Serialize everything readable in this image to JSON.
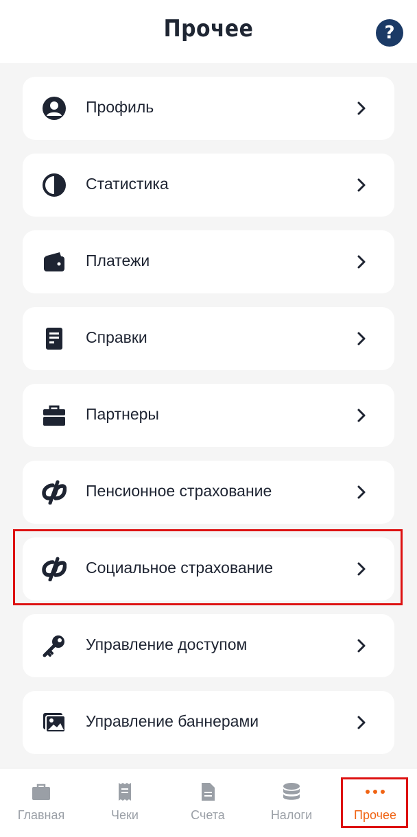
{
  "header": {
    "title": "Прочее",
    "help_label": "?"
  },
  "menu": {
    "items": [
      {
        "label": "Профиль",
        "icon": "user-circle-icon"
      },
      {
        "label": "Статистика",
        "icon": "pie-chart-icon"
      },
      {
        "label": "Платежи",
        "icon": "wallet-icon"
      },
      {
        "label": "Справки",
        "icon": "document-icon"
      },
      {
        "label": "Партнеры",
        "icon": "briefcase-icon"
      },
      {
        "label": "Пенсионное страхование",
        "icon": "sfr-logo-icon"
      },
      {
        "label": "Социальное страхование",
        "icon": "sfr-logo-icon"
      },
      {
        "label": "Управление доступом",
        "icon": "key-icon"
      },
      {
        "label": "Управление баннерами",
        "icon": "image-gallery-icon"
      }
    ]
  },
  "tabbar": {
    "tabs": [
      {
        "label": "Главная",
        "icon": "briefcase-icon"
      },
      {
        "label": "Чеки",
        "icon": "receipt-icon"
      },
      {
        "label": "Счета",
        "icon": "document-icon"
      },
      {
        "label": "Налоги",
        "icon": "coins-stack-icon"
      },
      {
        "label": "Прочее",
        "icon": "more-dots-icon"
      }
    ],
    "active": "Прочее"
  },
  "colors": {
    "accent": "#f06414",
    "dark": "#1e2432",
    "help_bg": "#1b3a66",
    "highlight": "#dd1111",
    "inactive": "#9a9fa6"
  }
}
